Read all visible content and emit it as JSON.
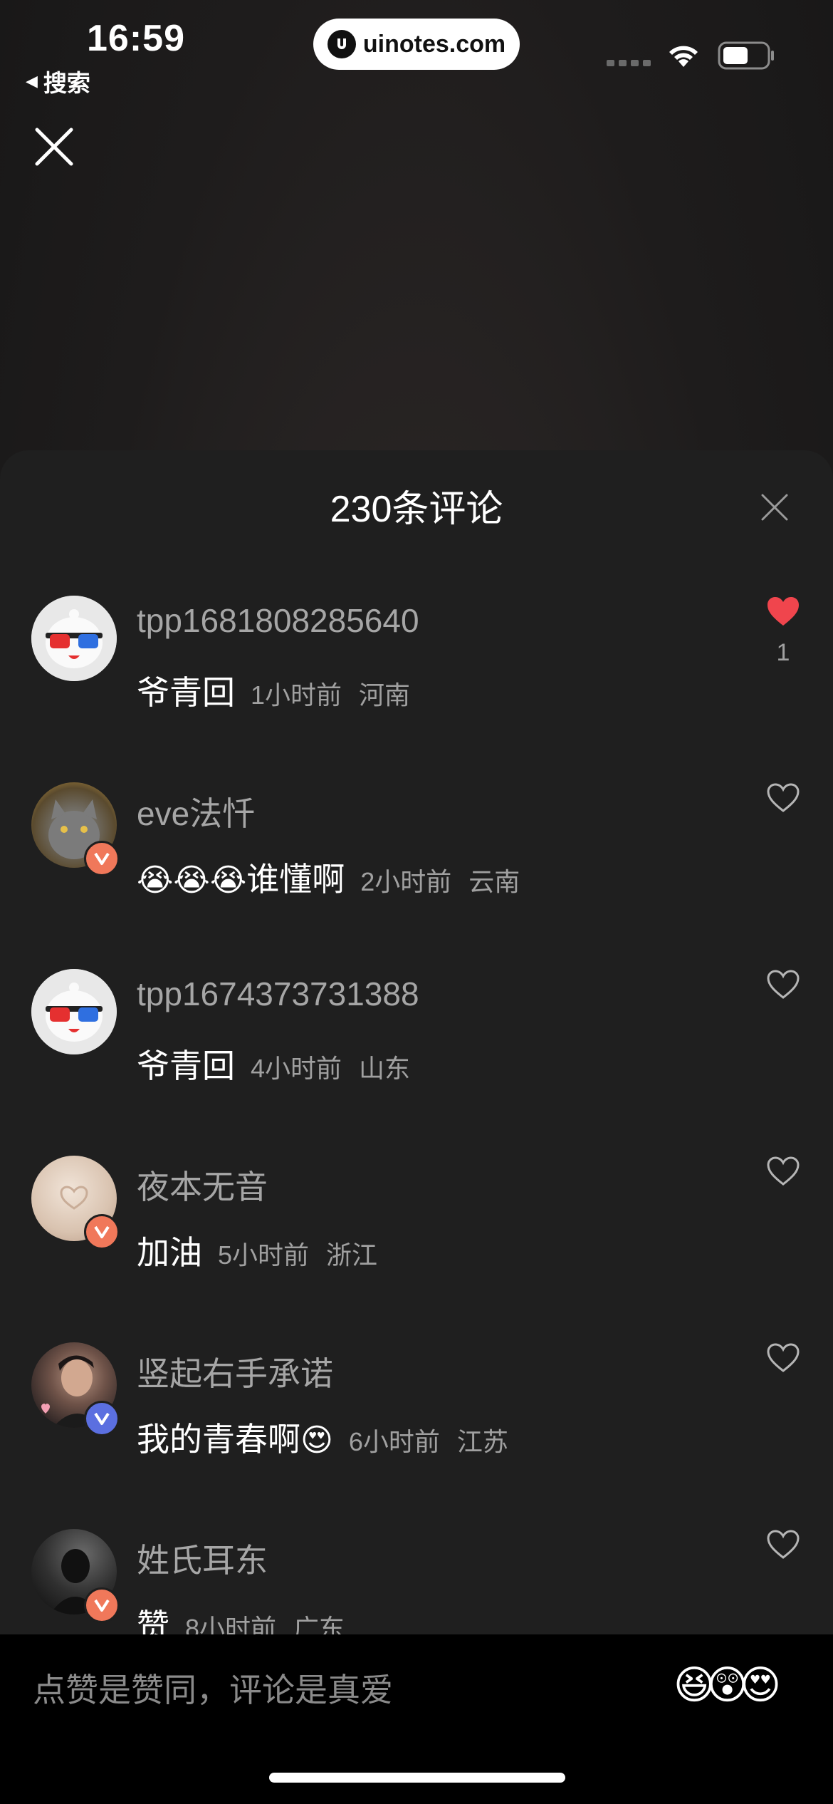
{
  "status_bar": {
    "time": "16:59",
    "back_label": "搜索",
    "url": "uinotes.com"
  },
  "sheet": {
    "title": "230条评论"
  },
  "comments": [
    {
      "username": "tpp1681808285640",
      "text": "爷青回",
      "time": "1小时前",
      "location": "河南",
      "liked": true,
      "like_count": "1",
      "avatar": "3d-glasses-robot-avatar"
    },
    {
      "username": "eve法忏",
      "emoji": "😭😭😭",
      "text": "谁懂啊",
      "time": "2小时前",
      "location": "云南",
      "liked": false,
      "avatar": "cat-photo-avatar",
      "badge": "orange-v"
    },
    {
      "username": "tpp1674373731388",
      "text": "爷青回",
      "time": "4小时前",
      "location": "山东",
      "liked": false,
      "avatar": "3d-glasses-robot-avatar"
    },
    {
      "username": "夜本无音",
      "text": "加油",
      "time": "5小时前",
      "location": "浙江",
      "liked": false,
      "avatar": "beige-heart-avatar",
      "badge": "orange-v"
    },
    {
      "username": "竖起右手承诺",
      "text": "我的青春啊",
      "emoji": "😍",
      "time": "6小时前",
      "location": "江苏",
      "liked": false,
      "avatar": "man-portrait-avatar",
      "badge": "blue-v"
    },
    {
      "username": "姓氏耳东",
      "text": "赞",
      "time": "8小时前",
      "location": "广东",
      "liked": false,
      "avatar": "dark-silhouette-avatar",
      "badge": "orange-v"
    }
  ],
  "input": {
    "placeholder": "点赞是赞同，评论是真爱",
    "emojis": [
      "😆",
      "😲",
      "😍"
    ]
  },
  "colors": {
    "like_red": "#f0454d",
    "sheet_bg": "#1f1f1f",
    "badge_orange": "#f0785a",
    "badge_blue": "#5b6fe0"
  }
}
